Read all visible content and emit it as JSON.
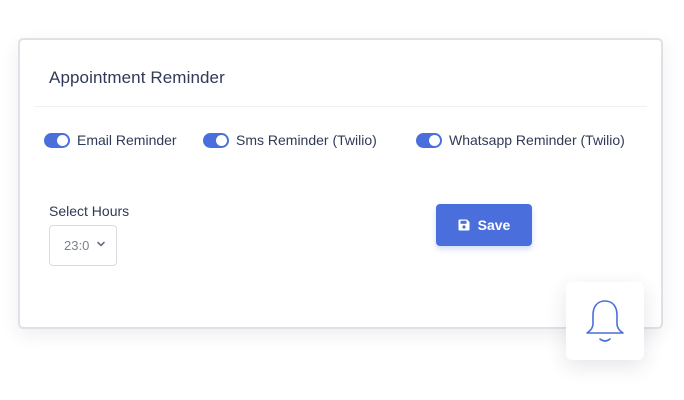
{
  "card": {
    "title": "Appointment Reminder"
  },
  "toggles": [
    {
      "label": "Email Reminder",
      "on": true
    },
    {
      "label": "Sms Reminder (Twilio)",
      "on": true
    },
    {
      "label": "Whatsapp Reminder (Twilio)",
      "on": true
    }
  ],
  "hours": {
    "label": "Select Hours",
    "selected": "23:0"
  },
  "save": {
    "label": "Save",
    "icon": "floppy-disk-icon"
  },
  "bell": {
    "icon": "bell-icon"
  },
  "colors": {
    "accent": "#4a6fdc",
    "text": "#2f3a56",
    "border": "#dfe1e6"
  }
}
